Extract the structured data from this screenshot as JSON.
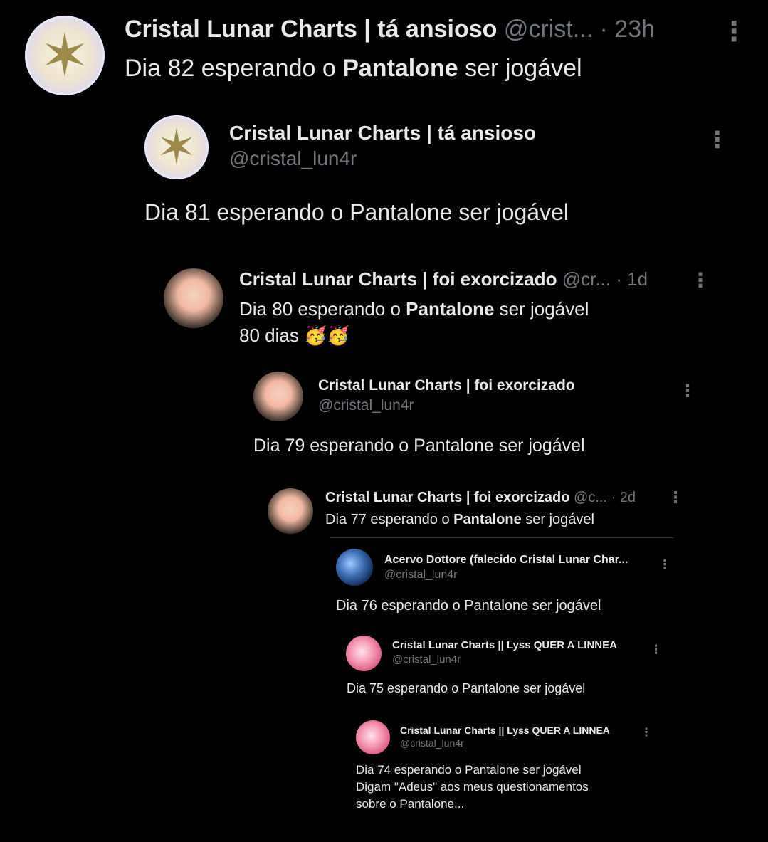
{
  "post": {
    "display_name": "Cristal Lunar Charts | tá ansioso",
    "handle": "@crist...",
    "time": "· 23h",
    "text_before": "Dia 82 esperando o ",
    "text_bold": "Pantalone",
    "text_after": " ser jogável"
  },
  "q1": {
    "display_name": "Cristal Lunar Charts | tá ansioso",
    "handle": "@cristal_lun4r",
    "text": "Dia 81 esperando o Pantalone ser jogável"
  },
  "q2": {
    "display_name": "Cristal Lunar Charts | foi exorcizado",
    "handle": "@cr...",
    "time": "· 1d",
    "text_before": "Dia 80 esperando o ",
    "text_bold": "Pantalone",
    "text_after": " ser jogável",
    "line2": "80 dias 🥳🥳"
  },
  "q3": {
    "display_name": "Cristal Lunar Charts | foi exorcizado",
    "handle": "@cristal_lun4r",
    "text": "Dia 79 esperando o Pantalone ser jogável"
  },
  "q4": {
    "display_name": "Cristal Lunar Charts | foi exorcizado",
    "handle": "@c...",
    "time": "· 2d",
    "text_before": "Dia 77 esperando o ",
    "text_bold": "Pantalone",
    "text_after": " ser jogável"
  },
  "q5": {
    "display_name": "Acervo Dottore (falecido Cristal Lunar Char...",
    "handle": "@cristal_lun4r",
    "text": "Dia 76 esperando o Pantalone ser jogável"
  },
  "q6": {
    "display_name": "Cristal Lunar Charts || Lyss QUER A LINNEA",
    "handle": "@cristal_lun4r",
    "text": "Dia 75 esperando o Pantalone ser jogável"
  },
  "q7": {
    "display_name": "Cristal Lunar Charts || Lyss QUER A LINNEA",
    "handle": "@cristal_lun4r",
    "line1": "Dia 74 esperando o Pantalone ser jogável",
    "line2": "Digam \"Adeus\" aos meus questionamentos",
    "line3": "sobre o Pantalone..."
  },
  "icons": {
    "more": "more-vertical-icon",
    "avatar_style_1": "star-emblem",
    "avatar_style_2": "anime-character",
    "avatar_style_3": "blue-character",
    "avatar_style_4": "pink-character"
  },
  "glyphs": {
    "more": "⋮",
    "star": "✶"
  },
  "colors": {
    "background": "#000000",
    "text": "#e7e9ea",
    "secondary": "#71767b"
  }
}
